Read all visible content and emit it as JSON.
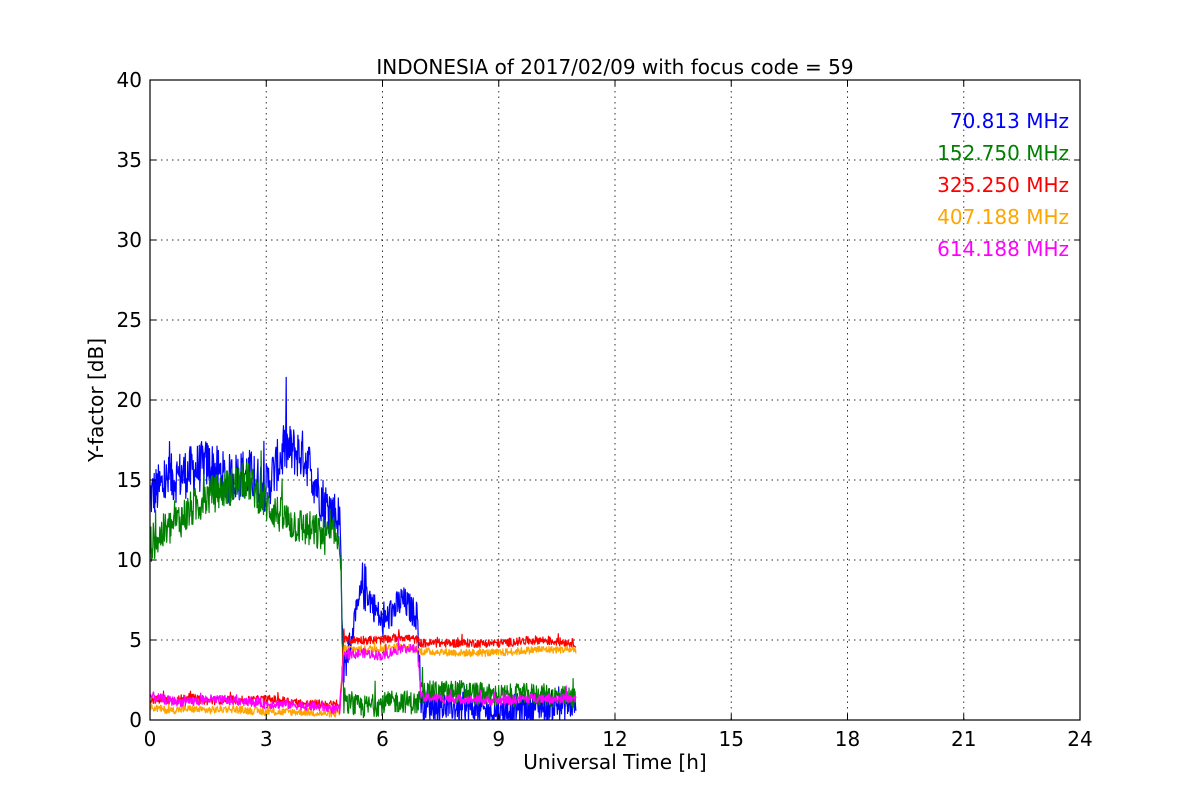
{
  "chart_data": {
    "type": "line",
    "title": "INDONESIA of 2017/02/09 with focus code = 59",
    "xlabel": "Universal Time [h]",
    "ylabel": "Y-factor [dB]",
    "xlim": [
      0,
      24
    ],
    "ylim": [
      0,
      40
    ],
    "xticks": [
      0,
      3,
      6,
      9,
      12,
      15,
      18,
      21,
      24
    ],
    "yticks": [
      0,
      5,
      10,
      15,
      20,
      25,
      30,
      35,
      40
    ],
    "grid": true,
    "legend_position": "top-right",
    "series": [
      {
        "name": "70.813 MHz",
        "color": "#0000ff",
        "x": [
          0,
          0.5,
          1,
          1.5,
          2,
          2.5,
          3,
          3.5,
          4,
          4.5,
          4.9,
          5.0,
          5.5,
          6.0,
          6.5,
          6.9,
          7.0,
          8.0,
          9.0,
          10.0,
          11.0
        ],
        "y": [
          14.0,
          15.0,
          15.5,
          16.0,
          15.0,
          15.5,
          14.5,
          17.0,
          16.5,
          13.5,
          12.5,
          3.0,
          8.5,
          6.0,
          7.5,
          6.5,
          1.0,
          0.8,
          0.5,
          0.9,
          1.0
        ]
      },
      {
        "name": "152.750 MHz",
        "color": "#008000",
        "x": [
          0,
          0.5,
          1,
          1.5,
          2,
          2.5,
          3,
          3.5,
          4,
          4.5,
          4.9,
          5.0,
          5.5,
          6.0,
          6.5,
          6.9,
          7.0,
          8.0,
          9.0,
          10.0,
          11.0
        ],
        "y": [
          11.0,
          12.0,
          13.0,
          14.0,
          14.5,
          15.0,
          13.5,
          12.5,
          12.0,
          11.5,
          11.5,
          1.0,
          0.8,
          1.0,
          1.2,
          1.0,
          1.7,
          1.8,
          1.5,
          1.6,
          1.3
        ]
      },
      {
        "name": "325.250 MHz",
        "color": "#ff0000",
        "x": [
          0,
          0.5,
          1,
          1.5,
          2,
          2.5,
          3,
          3.5,
          4,
          4.5,
          4.9,
          5.0,
          5.5,
          6.0,
          6.5,
          6.9,
          7.0,
          8.0,
          9.0,
          10.0,
          11.0
        ],
        "y": [
          1.3,
          1.2,
          1.4,
          1.2,
          1.3,
          1.2,
          1.3,
          1.2,
          1.0,
          1.0,
          0.9,
          5.0,
          5.0,
          5.0,
          5.2,
          5.0,
          4.8,
          4.8,
          4.8,
          5.0,
          4.8
        ]
      },
      {
        "name": "407.188 MHz",
        "color": "#ffa500",
        "x": [
          0,
          0.5,
          1,
          1.5,
          2,
          2.5,
          3,
          3.5,
          4,
          4.5,
          4.9,
          5.0,
          5.5,
          6.0,
          6.5,
          6.9,
          7.0,
          8.0,
          9.0,
          10.0,
          11.0
        ],
        "y": [
          0.8,
          0.6,
          0.7,
          0.6,
          0.7,
          0.6,
          0.5,
          0.5,
          0.5,
          0.4,
          0.4,
          4.5,
          4.4,
          4.5,
          4.6,
          4.4,
          4.3,
          4.2,
          4.2,
          4.4,
          4.4
        ]
      },
      {
        "name": "614.188 MHz",
        "color": "#ff00ff",
        "x": [
          0,
          0.5,
          1,
          1.5,
          2,
          2.5,
          3,
          3.5,
          4,
          4.5,
          4.9,
          5.0,
          5.5,
          6.0,
          6.5,
          6.9,
          7.0,
          8.0,
          9.0,
          10.0,
          11.0
        ],
        "y": [
          1.5,
          1.2,
          1.1,
          1.3,
          1.2,
          1.2,
          1.0,
          1.0,
          0.9,
          0.8,
          0.6,
          4.0,
          4.2,
          4.0,
          4.5,
          4.4,
          1.4,
          1.3,
          1.2,
          1.4,
          1.3
        ]
      }
    ]
  }
}
